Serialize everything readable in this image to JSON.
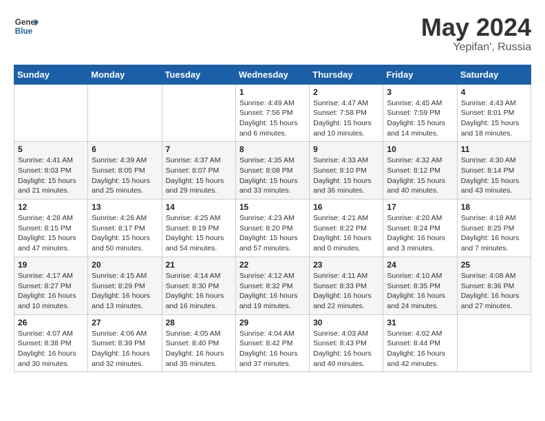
{
  "header": {
    "logo_general": "General",
    "logo_blue": "Blue",
    "month_year": "May 2024",
    "location": "Yepifan', Russia"
  },
  "days_of_week": [
    "Sunday",
    "Monday",
    "Tuesday",
    "Wednesday",
    "Thursday",
    "Friday",
    "Saturday"
  ],
  "weeks": [
    [
      {
        "day": "",
        "info": ""
      },
      {
        "day": "",
        "info": ""
      },
      {
        "day": "",
        "info": ""
      },
      {
        "day": "1",
        "info": "Sunrise: 4:49 AM\nSunset: 7:56 PM\nDaylight: 15 hours\nand 6 minutes."
      },
      {
        "day": "2",
        "info": "Sunrise: 4:47 AM\nSunset: 7:58 PM\nDaylight: 15 hours\nand 10 minutes."
      },
      {
        "day": "3",
        "info": "Sunrise: 4:45 AM\nSunset: 7:59 PM\nDaylight: 15 hours\nand 14 minutes."
      },
      {
        "day": "4",
        "info": "Sunrise: 4:43 AM\nSunset: 8:01 PM\nDaylight: 15 hours\nand 18 minutes."
      }
    ],
    [
      {
        "day": "5",
        "info": "Sunrise: 4:41 AM\nSunset: 8:03 PM\nDaylight: 15 hours\nand 21 minutes."
      },
      {
        "day": "6",
        "info": "Sunrise: 4:39 AM\nSunset: 8:05 PM\nDaylight: 15 hours\nand 25 minutes."
      },
      {
        "day": "7",
        "info": "Sunrise: 4:37 AM\nSunset: 8:07 PM\nDaylight: 15 hours\nand 29 minutes."
      },
      {
        "day": "8",
        "info": "Sunrise: 4:35 AM\nSunset: 8:08 PM\nDaylight: 15 hours\nand 33 minutes."
      },
      {
        "day": "9",
        "info": "Sunrise: 4:33 AM\nSunset: 8:10 PM\nDaylight: 15 hours\nand 36 minutes."
      },
      {
        "day": "10",
        "info": "Sunrise: 4:32 AM\nSunset: 8:12 PM\nDaylight: 15 hours\nand 40 minutes."
      },
      {
        "day": "11",
        "info": "Sunrise: 4:30 AM\nSunset: 8:14 PM\nDaylight: 15 hours\nand 43 minutes."
      }
    ],
    [
      {
        "day": "12",
        "info": "Sunrise: 4:28 AM\nSunset: 8:15 PM\nDaylight: 15 hours\nand 47 minutes."
      },
      {
        "day": "13",
        "info": "Sunrise: 4:26 AM\nSunset: 8:17 PM\nDaylight: 15 hours\nand 50 minutes."
      },
      {
        "day": "14",
        "info": "Sunrise: 4:25 AM\nSunset: 8:19 PM\nDaylight: 15 hours\nand 54 minutes."
      },
      {
        "day": "15",
        "info": "Sunrise: 4:23 AM\nSunset: 8:20 PM\nDaylight: 15 hours\nand 57 minutes."
      },
      {
        "day": "16",
        "info": "Sunrise: 4:21 AM\nSunset: 8:22 PM\nDaylight: 16 hours\nand 0 minutes."
      },
      {
        "day": "17",
        "info": "Sunrise: 4:20 AM\nSunset: 8:24 PM\nDaylight: 16 hours\nand 3 minutes."
      },
      {
        "day": "18",
        "info": "Sunrise: 4:18 AM\nSunset: 8:25 PM\nDaylight: 16 hours\nand 7 minutes."
      }
    ],
    [
      {
        "day": "19",
        "info": "Sunrise: 4:17 AM\nSunset: 8:27 PM\nDaylight: 16 hours\nand 10 minutes."
      },
      {
        "day": "20",
        "info": "Sunrise: 4:15 AM\nSunset: 8:29 PM\nDaylight: 16 hours\nand 13 minutes."
      },
      {
        "day": "21",
        "info": "Sunrise: 4:14 AM\nSunset: 8:30 PM\nDaylight: 16 hours\nand 16 minutes."
      },
      {
        "day": "22",
        "info": "Sunrise: 4:12 AM\nSunset: 8:32 PM\nDaylight: 16 hours\nand 19 minutes."
      },
      {
        "day": "23",
        "info": "Sunrise: 4:11 AM\nSunset: 8:33 PM\nDaylight: 16 hours\nand 22 minutes."
      },
      {
        "day": "24",
        "info": "Sunrise: 4:10 AM\nSunset: 8:35 PM\nDaylight: 16 hours\nand 24 minutes."
      },
      {
        "day": "25",
        "info": "Sunrise: 4:08 AM\nSunset: 8:36 PM\nDaylight: 16 hours\nand 27 minutes."
      }
    ],
    [
      {
        "day": "26",
        "info": "Sunrise: 4:07 AM\nSunset: 8:38 PM\nDaylight: 16 hours\nand 30 minutes."
      },
      {
        "day": "27",
        "info": "Sunrise: 4:06 AM\nSunset: 8:39 PM\nDaylight: 16 hours\nand 32 minutes."
      },
      {
        "day": "28",
        "info": "Sunrise: 4:05 AM\nSunset: 8:40 PM\nDaylight: 16 hours\nand 35 minutes."
      },
      {
        "day": "29",
        "info": "Sunrise: 4:04 AM\nSunset: 8:42 PM\nDaylight: 16 hours\nand 37 minutes."
      },
      {
        "day": "30",
        "info": "Sunrise: 4:03 AM\nSunset: 8:43 PM\nDaylight: 16 hours\nand 40 minutes."
      },
      {
        "day": "31",
        "info": "Sunrise: 4:02 AM\nSunset: 8:44 PM\nDaylight: 16 hours\nand 42 minutes."
      },
      {
        "day": "",
        "info": ""
      }
    ]
  ]
}
